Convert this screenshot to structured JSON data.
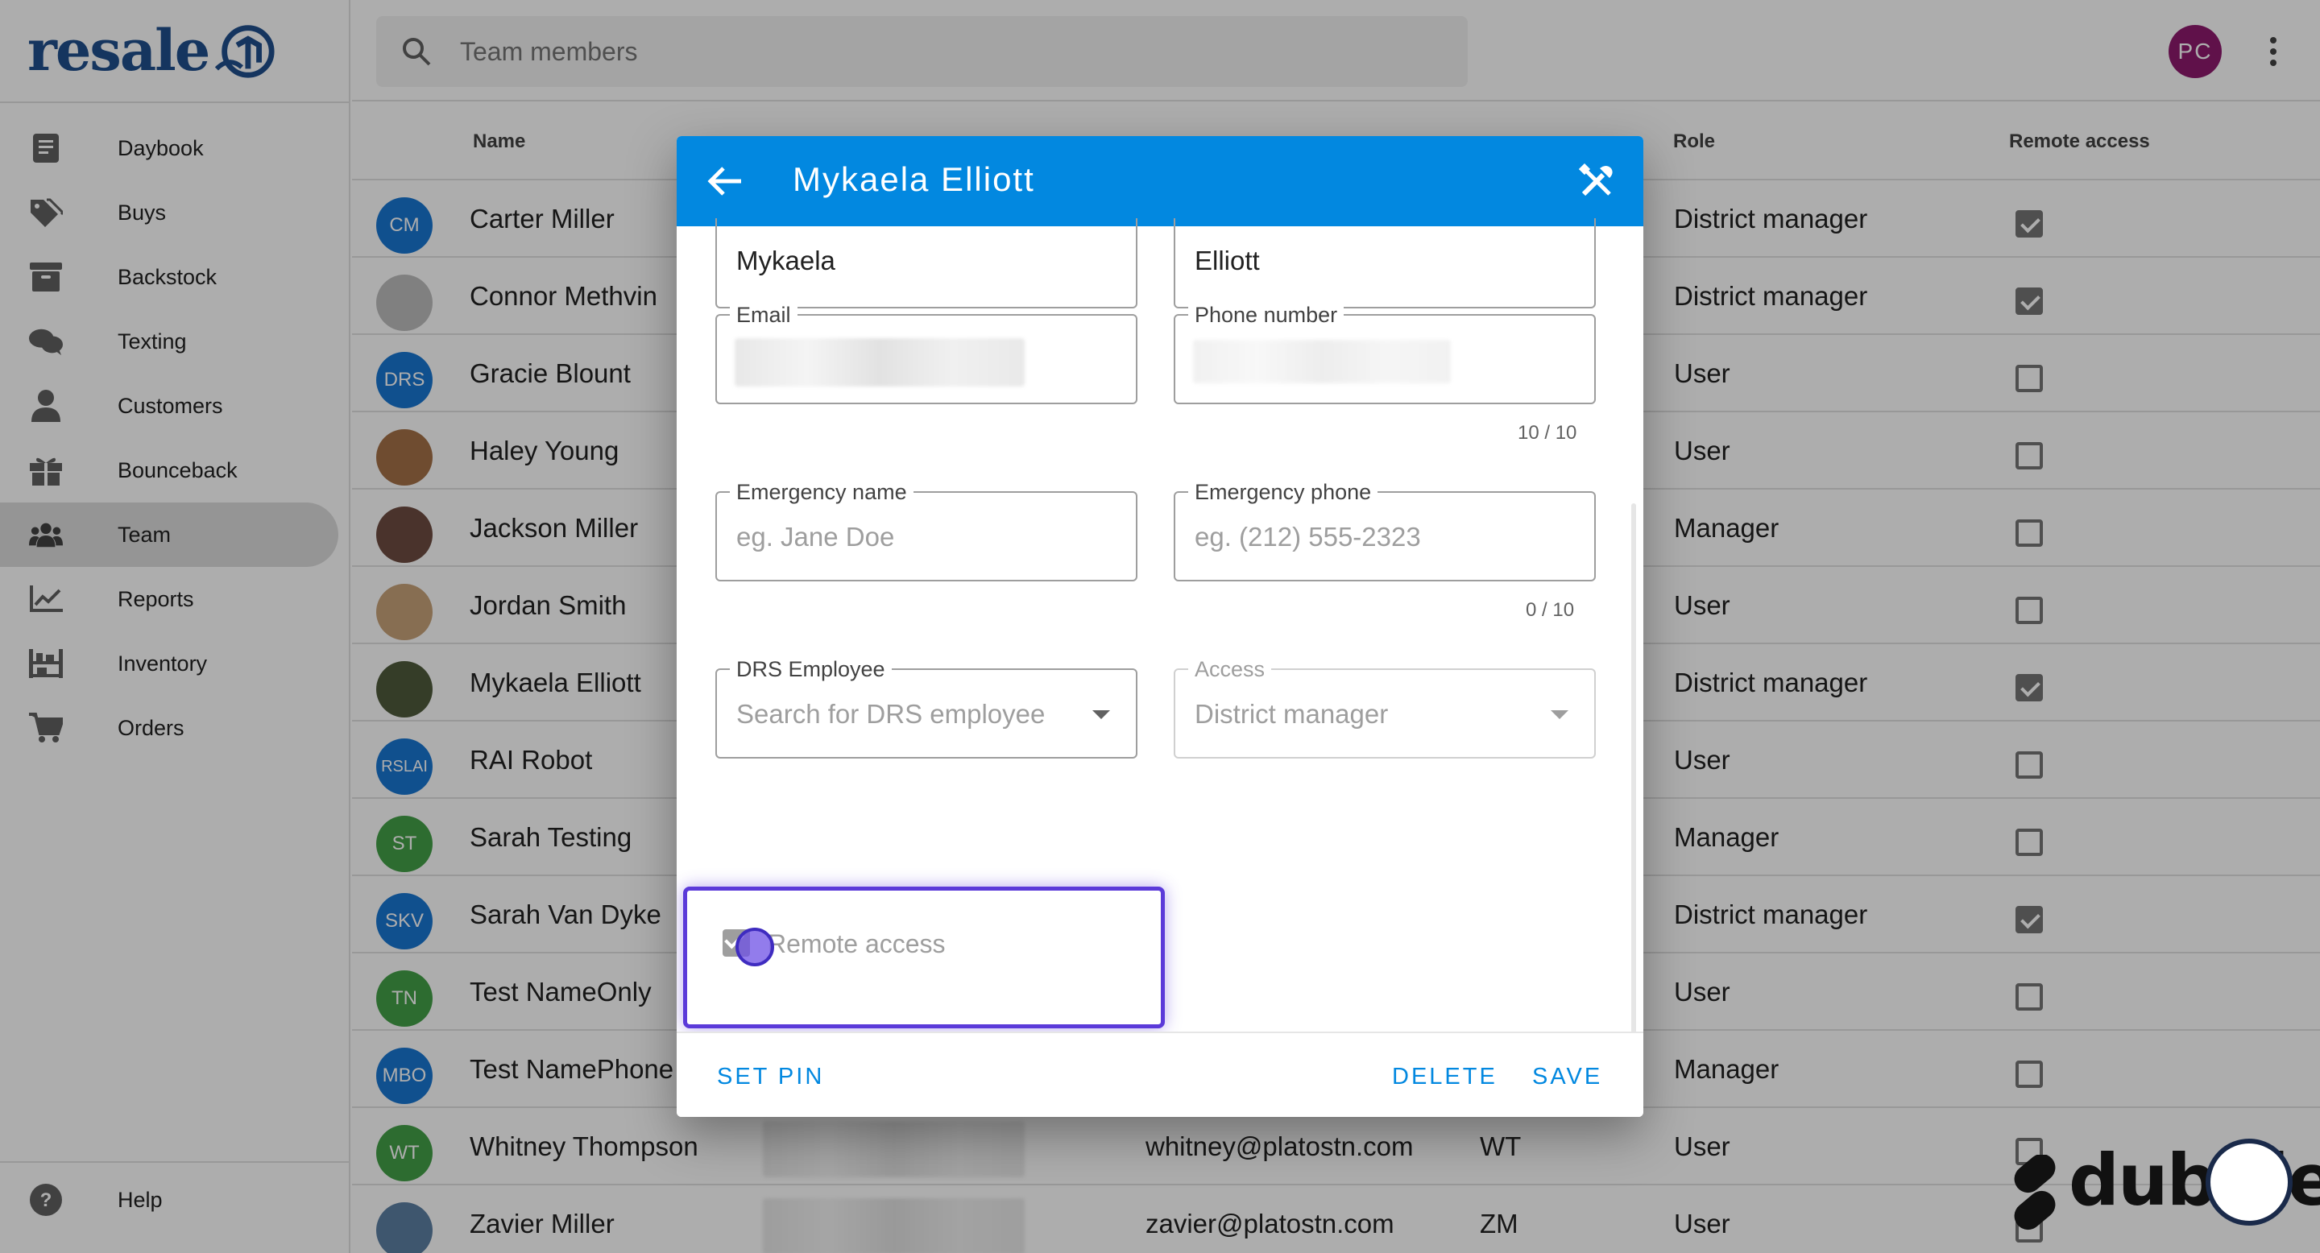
{
  "brand": {
    "logo_text": "resale"
  },
  "sidebar": {
    "items": [
      {
        "label": "Daybook",
        "icon": "book-icon",
        "active": false
      },
      {
        "label": "Buys",
        "icon": "tags-icon",
        "active": false
      },
      {
        "label": "Backstock",
        "icon": "archive-box-icon",
        "active": false
      },
      {
        "label": "Texting",
        "icon": "chat-bubbles-icon",
        "active": false
      },
      {
        "label": "Customers",
        "icon": "person-icon",
        "active": false
      },
      {
        "label": "Bounceback",
        "icon": "gift-icon",
        "active": false
      },
      {
        "label": "Team",
        "icon": "team-icon",
        "active": true
      },
      {
        "label": "Reports",
        "icon": "chart-line-icon",
        "active": false
      },
      {
        "label": "Inventory",
        "icon": "shelves-icon",
        "active": false
      },
      {
        "label": "Orders",
        "icon": "cart-icon",
        "active": false
      }
    ],
    "help_label": "Help"
  },
  "topbar": {
    "search_placeholder": "Team members",
    "user_initials": "PC",
    "user_avatar_color": "#8e1a6e"
  },
  "table": {
    "headers": {
      "name": "Name",
      "role": "Role",
      "remote": "Remote access"
    },
    "rows": [
      {
        "initials": "CM",
        "avatar_color": "#1976d2",
        "name": "Carter Miller",
        "email": "",
        "drs": "",
        "role": "District manager",
        "remote": true
      },
      {
        "initials": "",
        "avatar_color": "#bdbdbd",
        "name": "Connor Methvin",
        "email": "",
        "drs": "",
        "role": "District manager",
        "remote": true
      },
      {
        "initials": "DRS",
        "avatar_color": "#1976d2",
        "name": "Gracie Blount",
        "email": "",
        "drs": "",
        "role": "User",
        "remote": false
      },
      {
        "initials": "",
        "avatar_color": "#a47148",
        "name": "Haley Young",
        "email": "",
        "drs": "",
        "role": "User",
        "remote": false
      },
      {
        "initials": "",
        "avatar_color": "#6d4c41",
        "name": "Jackson Miller",
        "email": "",
        "drs": "",
        "role": "Manager",
        "remote": false
      },
      {
        "initials": "",
        "avatar_color": "#c8a27a",
        "name": "Jordan Smith",
        "email": "",
        "drs": "",
        "role": "User",
        "remote": false
      },
      {
        "initials": "",
        "avatar_color": "#4e5b3c",
        "name": "Mykaela Elliott",
        "email": "",
        "drs": "",
        "role": "District manager",
        "remote": true
      },
      {
        "initials": "RSLAI",
        "avatar_color": "#1976d2",
        "name": "RAI Robot",
        "email": "",
        "drs": "",
        "role": "User",
        "remote": false
      },
      {
        "initials": "ST",
        "avatar_color": "#43a047",
        "name": "Sarah Testing",
        "email": "",
        "drs": "",
        "role": "Manager",
        "remote": false
      },
      {
        "initials": "SKV",
        "avatar_color": "#1976d2",
        "name": "Sarah Van Dyke",
        "email": "",
        "drs": "",
        "role": "District manager",
        "remote": true
      },
      {
        "initials": "TN",
        "avatar_color": "#43a047",
        "name": "Test NameOnly",
        "email": "",
        "drs": "",
        "role": "User",
        "remote": false
      },
      {
        "initials": "MBO",
        "avatar_color": "#1976d2",
        "name": "Test NamePhone",
        "email": "",
        "drs": "",
        "role": "Manager",
        "remote": false
      },
      {
        "initials": "WT",
        "avatar_color": "#43a047",
        "name": "Whitney Thompson",
        "email": "whitney@platostn.com",
        "drs": "WT",
        "role": "User",
        "remote": false
      },
      {
        "initials": "",
        "avatar_color": "#5c7fa3",
        "name": "Zavier Miller",
        "email": "zavier@platostn.com",
        "drs": "ZM",
        "role": "User",
        "remote": false
      }
    ]
  },
  "dialog": {
    "title": "Mykaela Elliott",
    "header_color": "#0288e0",
    "first_name": "Mykaela",
    "last_name": "Elliott",
    "email_label": "Email",
    "phone_label": "Phone number",
    "phone_counter": "10 / 10",
    "emergency_name_label": "Emergency name",
    "emergency_name_placeholder": "eg. Jane Doe",
    "emergency_phone_label": "Emergency phone",
    "emergency_phone_placeholder": "eg. (212) 555-2323",
    "emergency_phone_counter": "0 / 10",
    "drs_label": "DRS Employee",
    "drs_placeholder": "Search for DRS employee",
    "access_label": "Access",
    "access_value": "District manager",
    "remote_access_label": "Remote access",
    "remote_access_checked": true,
    "set_pin_label": "SET PIN",
    "delete_label": "DELETE",
    "save_label": "SAVE"
  },
  "watermark": {
    "text": "dubble"
  }
}
